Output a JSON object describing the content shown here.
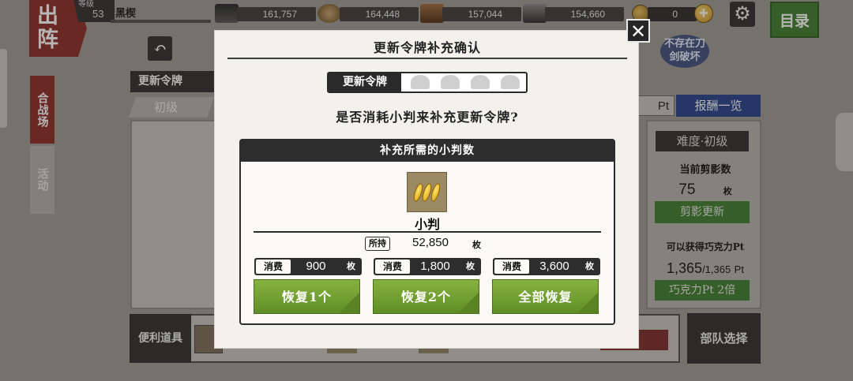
{
  "top": {
    "sortie_label": "出阵",
    "level_label": "等级",
    "level": "53",
    "player_name": "黑楔",
    "resources": [
      "161,757",
      "164,448",
      "157,044",
      "154,660"
    ],
    "gold_count": "0",
    "menu_label": "目录"
  },
  "left": {
    "tab_battle": "合战场",
    "tab_event": "活动",
    "ticket_tab": "更新令牌",
    "difficulty_tab": "初级"
  },
  "right": {
    "pt_label": "Pt",
    "reward_label": "报酬一览",
    "difficulty": "难度·初级",
    "current_silhouettes_label": "当前剪影数",
    "current_silhouettes": "75",
    "unit_mai": "枚",
    "refresh_label": "剪影更新",
    "choco_label": "可以获得巧克力Pt",
    "choco_value": "1,365",
    "choco_max": "/1,365",
    "pt_unit": "Pt",
    "double_label": "巧克力Pt 2倍",
    "mascot_text": "不存在刀剑破坏"
  },
  "bottom": {
    "items_label": "便利道具",
    "team_label": "部队选择"
  },
  "dialog": {
    "title": "更新令牌补充确认",
    "ticket_label": "更新令牌",
    "question": "是否消耗小判来补充更新令牌?",
    "section_title": "补充所需的小判数",
    "item_name": "小判",
    "held_label": "所持",
    "held_value": "52,850",
    "unit": "枚",
    "cost_label": "消费",
    "costs": [
      "900",
      "1,800",
      "3,600"
    ],
    "buttons": [
      "恢复1个",
      "恢复2个",
      "全部恢复"
    ]
  },
  "colors": {
    "dialog_bg": "#f3f1ec",
    "dark": "#2d2d2d",
    "button_green": "#6f9e2f",
    "accent_red": "#8c2a26"
  }
}
